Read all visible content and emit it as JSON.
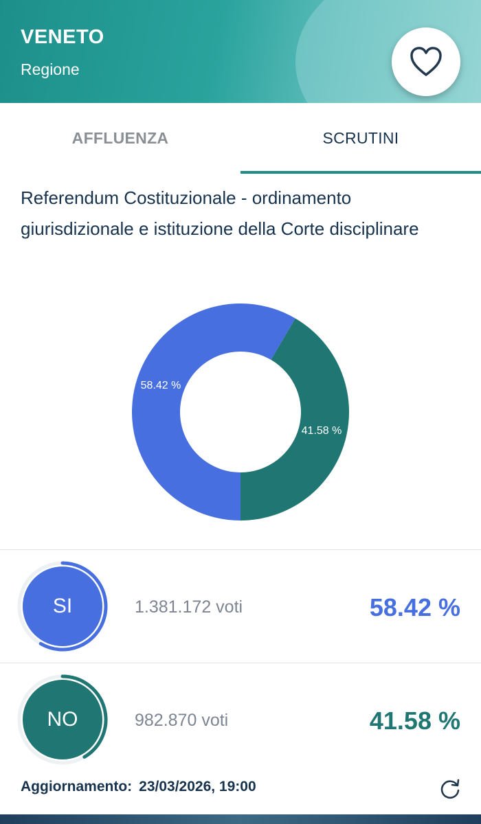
{
  "header": {
    "region_name": "VENETO",
    "region_type": "Regione",
    "favorite_icon": "heart-outline-icon"
  },
  "tabs": [
    {
      "label": "AFFLUENZA",
      "active": false
    },
    {
      "label": "SCRUTINI",
      "active": true
    }
  ],
  "referendum_title": "Referendum Costituzionale - ordinamento giurisdizionale e istituzione della Corte disciplinare",
  "chart_data": {
    "type": "pie",
    "variant": "donut",
    "slices": [
      {
        "label": "SI",
        "value": 58.42,
        "display": "58.42 %",
        "color": "#476fdf"
      },
      {
        "label": "NO",
        "value": 41.58,
        "display": "41.58 %",
        "color": "#207672"
      }
    ]
  },
  "results": [
    {
      "label": "SI",
      "votes": "1.381.172 voti",
      "percent": "58.42 %",
      "fraction": 0.5842,
      "color": "#476fdf"
    },
    {
      "label": "NO",
      "votes": "982.870 voti",
      "percent": "41.58 %",
      "fraction": 0.4158,
      "color": "#207672"
    }
  ],
  "footer": {
    "update_label": "Aggiornamento:",
    "update_value": "23/03/2026, 19:00",
    "refresh_icon": "refresh-icon"
  }
}
